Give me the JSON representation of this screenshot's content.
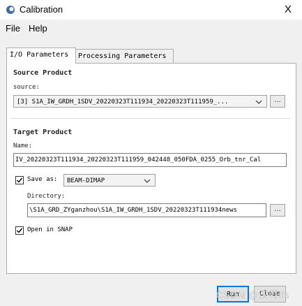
{
  "window": {
    "title": "Calibration",
    "close_glyph": "X"
  },
  "menu": {
    "file": "File",
    "help": "Help"
  },
  "tabs": [
    {
      "label": "I/O Parameters",
      "active": true
    },
    {
      "label": "Processing Parameters",
      "active": false
    }
  ],
  "source_product": {
    "group_title": "Source Product",
    "label": "source:",
    "selected": "[3] S1A_IW_GRDH_1SDV_20220323T111934_20220323T111959_...",
    "browse_label": "..."
  },
  "target_product": {
    "group_title": "Target Product",
    "name_label": "Name:",
    "name_value": "IV_20220323T111934_20220323T111959_042448_050FDA_0255_Orb_tnr_Cal",
    "save_as_label": "Save as:",
    "save_as_checked": true,
    "format_selected": "BEAM-DIMAP",
    "directory_label": "Directory:",
    "directory_value": "\\S1A_GRD_ZYganzhou\\S1A_IW_GRDH_1SDV_20220323T111934news",
    "browse_label": "...",
    "open_in_snap_label": "Open in SNAP",
    "open_in_snap_checked": true
  },
  "footer": {
    "run_label": "Run",
    "close_label": "Close"
  },
  "watermark": "CSDN @汉得lfs",
  "colors": {
    "accent": "#0078d7",
    "app_icon": "#3a6ea5"
  }
}
